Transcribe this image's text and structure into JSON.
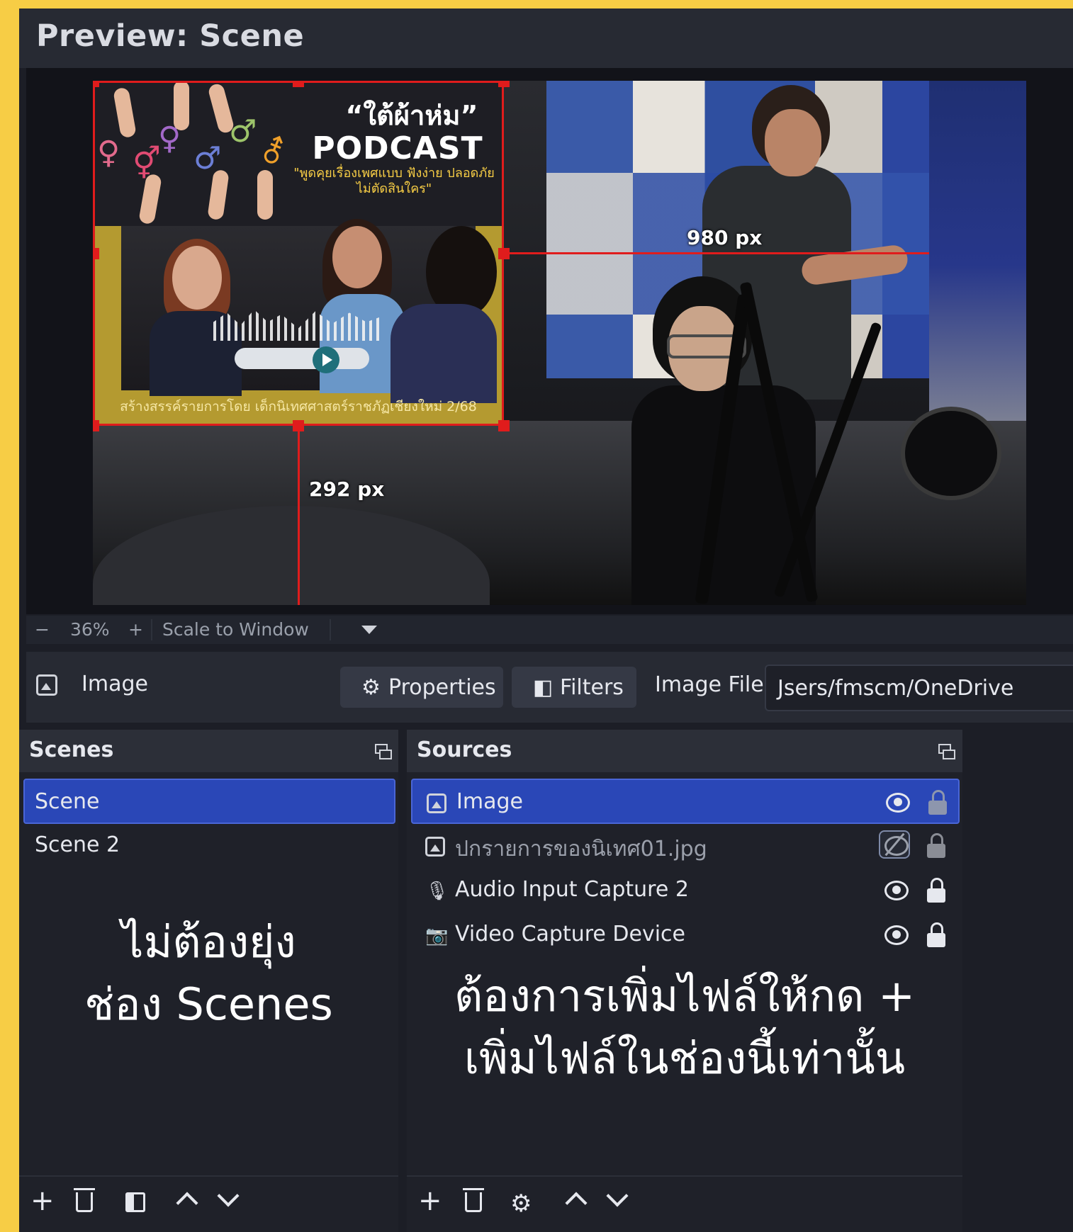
{
  "preview": {
    "title": "Preview: Scene",
    "poster": {
      "quote": "“ใต้ผ้าห่ม”",
      "title": "PODCAST",
      "subtitle": "\"พูดคุยเรื่องเพศแบบ ฟังง่าย ปลอดภัย ไม่ตัดสินใคร\"",
      "footer": "สร้างสรรค์รายการโดย เด็กนิเทศศาสตร์ราชภัฏเชียงใหม่ 2/68"
    },
    "measure_right": "980 px",
    "measure_bottom": "292 px"
  },
  "zoom": {
    "minus": "−",
    "value": "36%",
    "plus": "+",
    "mode": "Scale to Window"
  },
  "context": {
    "source_type": "Image",
    "properties_label": "Properties",
    "filters_label": "Filters",
    "image_file_label": "Image File",
    "image_file_value": "Jsers/fmscm/OneDrive"
  },
  "scenes": {
    "title": "Scenes",
    "items": [
      {
        "label": "Scene",
        "selected": true
      },
      {
        "label": "Scene 2",
        "selected": false
      }
    ],
    "annotation_line1": "ไม่ต้องยุ่ง",
    "annotation_line2": "ช่อง Scenes"
  },
  "sources": {
    "title": "Sources",
    "items": [
      {
        "label": "Image",
        "icon": "image-icon",
        "visible": true,
        "locked": false,
        "selected": true
      },
      {
        "label": "ปกรายการของนิเทศ01.jpg",
        "icon": "image-icon",
        "visible": false,
        "locked": false,
        "selected": false
      },
      {
        "label": "Audio Input Capture 2",
        "icon": "microphone-icon",
        "visible": true,
        "locked": true,
        "selected": false
      },
      {
        "label": "Video Capture Device",
        "icon": "camera-icon",
        "visible": true,
        "locked": true,
        "selected": false
      }
    ],
    "annotation_line1": "ต้องการเพิ่มไฟล์ให้กด +",
    "annotation_line2": "เพิ่มไฟล์ในช่องนี้เท่านั้น"
  },
  "colors": {
    "frame": "#f7cd45",
    "selection_blue": "#2a47b7",
    "transform_red": "#e01c1c"
  }
}
